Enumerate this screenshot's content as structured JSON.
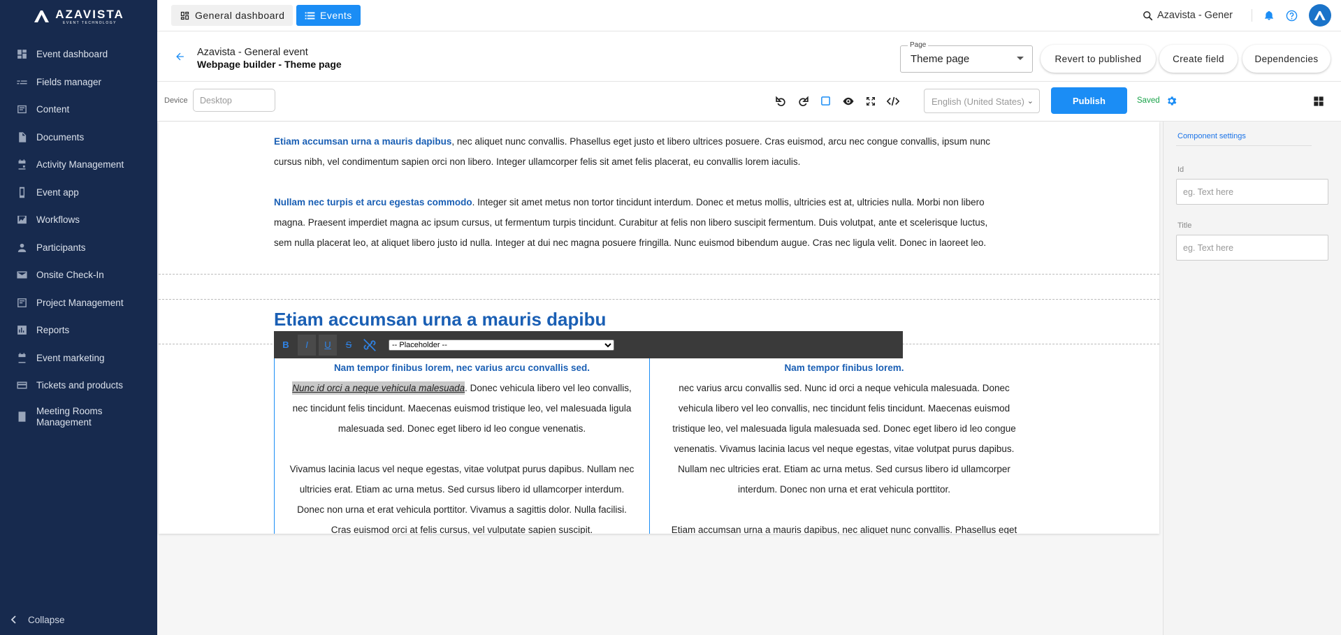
{
  "brand": {
    "name": "AZAVISTA",
    "tagline": "EVENT TECHNOLOGY"
  },
  "sidebar": {
    "items": [
      {
        "label": "Event dashboard",
        "icon": "dashboard-icon"
      },
      {
        "label": "Fields manager",
        "icon": "fields-icon"
      },
      {
        "label": "Content",
        "icon": "content-icon"
      },
      {
        "label": "Documents",
        "icon": "document-icon"
      },
      {
        "label": "Activity Management",
        "icon": "calendar-icon"
      },
      {
        "label": "Event app",
        "icon": "phone-icon"
      },
      {
        "label": "Workflows",
        "icon": "workflow-icon"
      },
      {
        "label": "Participants",
        "icon": "person-icon"
      },
      {
        "label": "Onsite Check-In",
        "icon": "mail-icon"
      },
      {
        "label": "Project Management",
        "icon": "project-icon"
      },
      {
        "label": "Reports",
        "icon": "chart-icon"
      },
      {
        "label": "Event marketing",
        "icon": "calendar-icon"
      },
      {
        "label": "Tickets and products",
        "icon": "card-icon"
      },
      {
        "label": "Meeting Rooms Management",
        "icon": "room-icon"
      }
    ],
    "collapse_label": "Collapse"
  },
  "topbar": {
    "general_tab": "General dashboard",
    "events_tab": "Events",
    "search_text": "Azavista - Gener"
  },
  "header": {
    "event_name": "Azavista - General event",
    "page_title": "Webpage builder - Theme page",
    "page_select_legend": "Page",
    "page_select_value": "Theme page",
    "revert_label": "Revert to published",
    "create_field_label": "Create field",
    "dependencies_label": "Dependencies"
  },
  "toolbar": {
    "device_label": "Device",
    "device_value": "Desktop",
    "language_value": "English (United States)",
    "publish_label": "Publish",
    "saved_label": "Saved"
  },
  "editor": {
    "p1_bold": "Etiam accumsan urna a mauris dapibus",
    "p1_line1": ", nec aliquet nunc convallis. Phasellus eget justo et libero ultrices posuere. Cras euismod, arcu nec congue convallis, ipsum nunc",
    "p1_line2": "cursus nibh, vel condimentum sapien orci non libero. Integer ullamcorper felis sit amet felis placerat, eu convallis lorem iaculis.",
    "p2_bold": "Nullam nec turpis et arcu egestas commodo",
    "p2_line1": ". Integer sit amet metus non tortor tincidunt interdum. Donec et metus mollis, ultricies est at, ultricies nulla. Morbi non libero",
    "p2_line2": "magna. Praesent imperdiet magna ac ipsum cursus, ut fermentum turpis tincidunt. Curabitur at felis non libero suscipit fermentum. Duis volutpat, ante et scelerisque luctus,",
    "p2_line3": "sem nulla placerat leo, at aliquet libero justo id nulla. Integer at dui nec magna posuere fringilla. Nunc euismod bibendum augue. Cras nec ligula velit. Donec in laoreet leo.",
    "heading": "Etiam accumsan urna a mauris dapibu",
    "placeholder_option": "-- Placeholder --",
    "left_col": {
      "heading": "Nam tempor finibus lorem, nec varius arcu convallis sed.",
      "highlight": "Nunc id orci a neque vehicula malesuada",
      "l1_rest": ". Donec vehicula libero vel leo convallis,",
      "l2": "nec tincidunt felis tincidunt. Maecenas euismod tristique leo, vel malesuada ligula",
      "l3": "malesuada sed. Donec eget libero id leo congue venenatis.",
      "l4": "Vivamus lacinia lacus vel neque egestas, vitae volutpat purus dapibus. Nullam nec",
      "l5": "ultricies erat. Etiam ac urna metus. Sed cursus libero id ullamcorper interdum.",
      "l6": "Donec non urna et erat vehicula porttitor. Vivamus a sagittis dolor. Nulla facilisi.",
      "l7": "Cras euismod orci at felis cursus, vel vulputate sapien suscipit."
    },
    "right_col": {
      "heading": "Nam tempor finibus lorem.",
      "l1": "nec varius arcu convallis sed. Nunc id orci a neque vehicula malesuada. Donec",
      "l2": "vehicula libero vel leo convallis, nec tincidunt felis tincidunt. Maecenas euismod",
      "l3": "tristique leo, vel malesuada ligula malesuada sed. Donec eget libero id leo congue",
      "l4": "venenatis. Vivamus lacinia lacus vel neque egestas, vitae volutpat purus dapibus.",
      "l5": "Nullam nec ultricies erat. Etiam ac urna metus. Sed cursus libero id ullamcorper",
      "l6": "interdum. Donec non urna et erat vehicula porttitor.",
      "l7": "Etiam accumsan urna a mauris dapibus, nec aliquet nunc convallis. Phasellus eget"
    }
  },
  "settings": {
    "title": "Component settings",
    "id_label": "Id",
    "id_placeholder": "eg. Text here",
    "title_label": "Title",
    "title_placeholder": "eg. Text here"
  },
  "colors": {
    "sidebar": "#172a4e",
    "accent": "#1b8df5",
    "heading": "#1a5fb4",
    "saved": "#1aa34a"
  }
}
